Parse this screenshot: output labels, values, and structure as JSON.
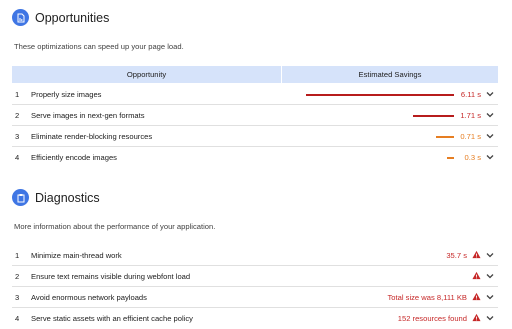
{
  "opportunities": {
    "title": "Opportunities",
    "description": "These optimizations can speed up your page load.",
    "columns": {
      "opportunity": "Opportunity",
      "savings": "Estimated Savings"
    },
    "rows": [
      {
        "index": "1",
        "label": "Properly size images",
        "value": "6.11 s",
        "fraction": 1.0,
        "color": "#b71c1c"
      },
      {
        "index": "2",
        "label": "Serve images in next-gen formats",
        "value": "1.71 s",
        "fraction": 0.28,
        "color": "#b71c1c"
      },
      {
        "index": "3",
        "label": "Eliminate render-blocking resources",
        "value": "0.71 s",
        "fraction": 0.12,
        "color": "#e67e22"
      },
      {
        "index": "4",
        "label": "Efficiently encode images",
        "value": "0.3 s",
        "fraction": 0.05,
        "color": "#e67e22"
      }
    ]
  },
  "diagnostics": {
    "title": "Diagnostics",
    "description": "More information about the performance of your application.",
    "rows": [
      {
        "index": "1",
        "label": "Minimize main-thread work",
        "value": "35.7 s"
      },
      {
        "index": "2",
        "label": "Ensure text remains visible during webfont load",
        "value": ""
      },
      {
        "index": "3",
        "label": "Avoid enormous network payloads",
        "value": "Total size was 8,111 KB"
      },
      {
        "index": "4",
        "label": "Serve static assets with an efficient cache policy",
        "value": "152 resources found"
      }
    ]
  },
  "colors": {
    "accent": "#3f76e4",
    "header_bg": "#d6e3fa",
    "fail": "#c62828",
    "average": "#e67e22"
  },
  "icons": {
    "opportunities": "file-chart-icon",
    "diagnostics": "clipboard-icon",
    "expand": "chevron-down-icon",
    "warning": "warning-triangle-icon"
  }
}
